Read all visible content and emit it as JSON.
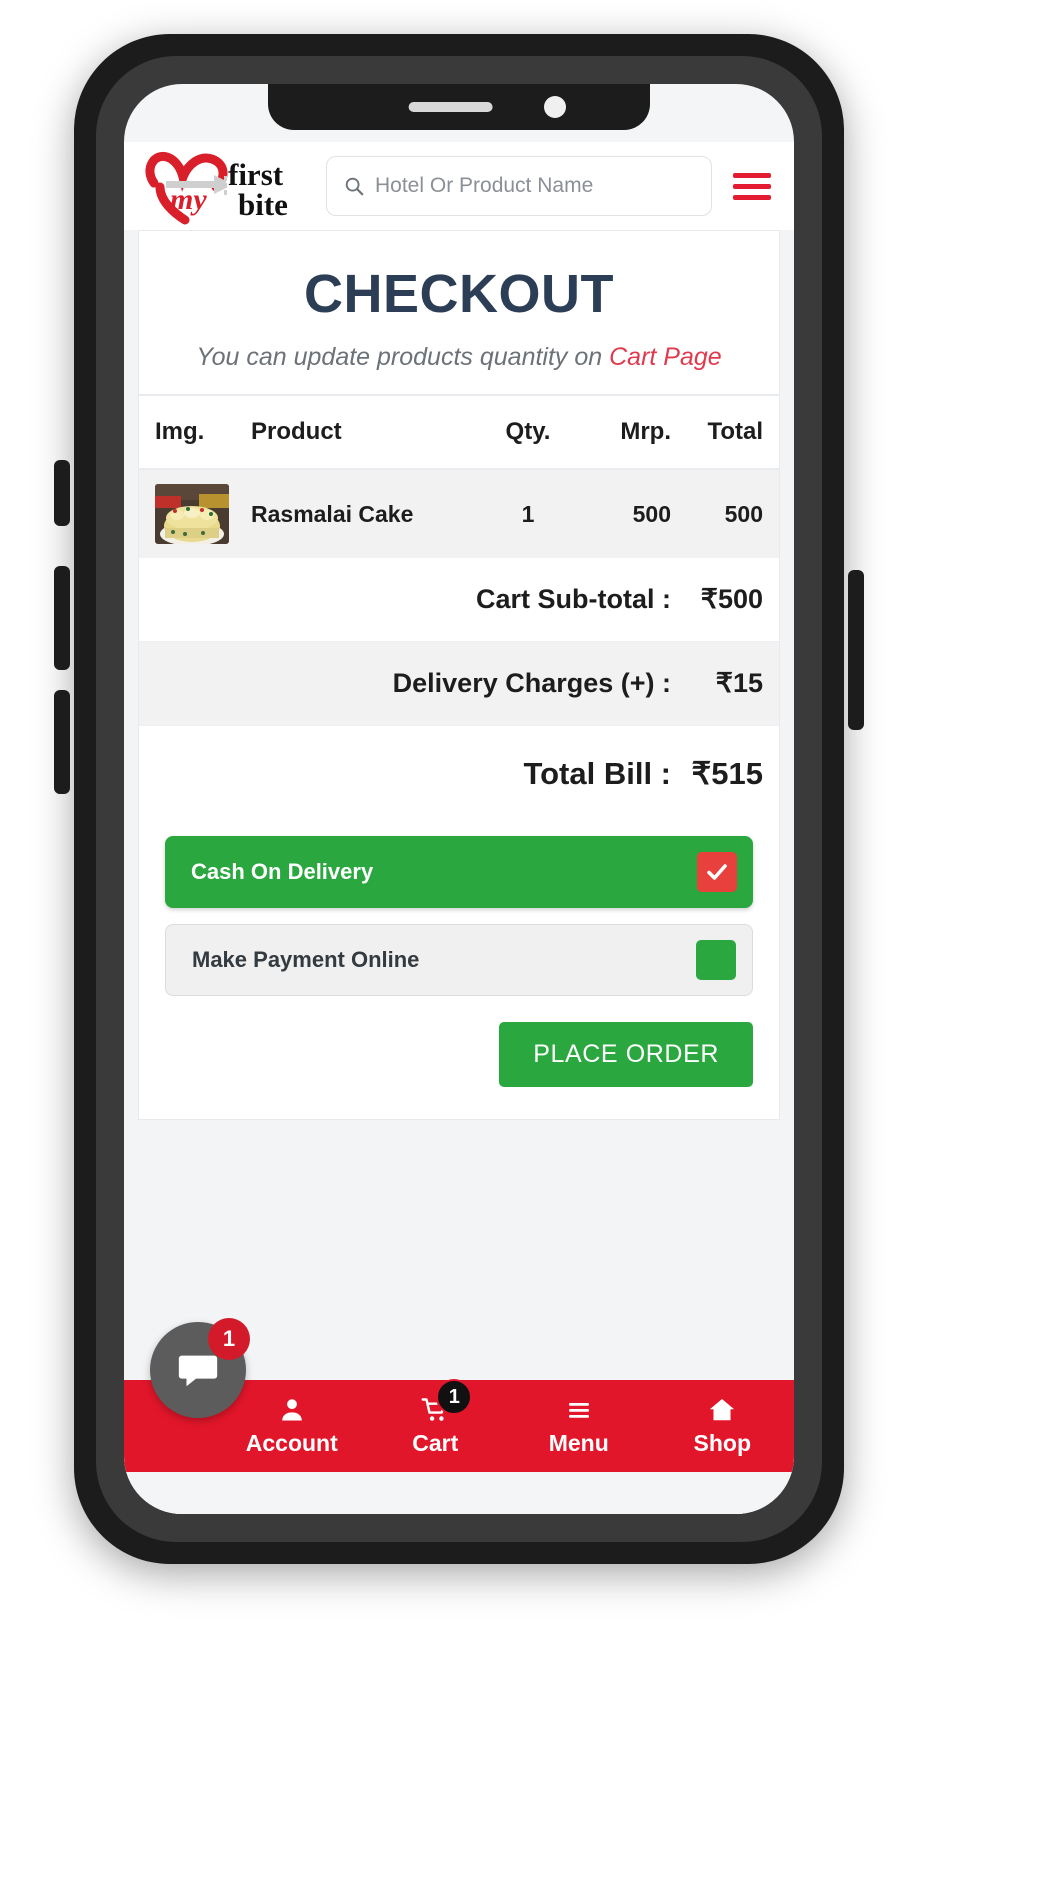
{
  "header": {
    "logo_text_line1": "my",
    "logo_text_line2": "first",
    "logo_text_line3": "bite",
    "logo_alt": "my first bite",
    "search_placeholder": "Hotel Or Product Name",
    "search_value": "",
    "menu_label": "Menu"
  },
  "checkout": {
    "title": "CHECKOUT",
    "subtitle_prefix": "You can update products quantity on ",
    "subtitle_link": "Cart Page"
  },
  "table": {
    "headers": {
      "img": "Img.",
      "product": "Product",
      "qty": "Qty.",
      "mrp": "Mrp.",
      "total": "Total"
    },
    "rows": [
      {
        "image_alt": "Rasmalai Cake",
        "product": "Rasmalai Cake",
        "qty": "1",
        "mrp": "500",
        "total": "500"
      }
    ]
  },
  "summary": {
    "subtotal_label": "Cart Sub-total :",
    "subtotal_value": "₹500",
    "delivery_label": "Delivery Charges (+) :",
    "delivery_value": "₹15",
    "total_label": "Total Bill :",
    "total_value": "₹515"
  },
  "payment": {
    "options": [
      {
        "label": "Cash On Delivery",
        "selected": true
      },
      {
        "label": "Make Payment Online",
        "selected": false
      }
    ],
    "place_order_label": "PLACE ORDER"
  },
  "chat": {
    "badge": "1"
  },
  "bottom_nav": {
    "items": [
      {
        "label": "Account",
        "icon": "user-icon",
        "badge": ""
      },
      {
        "label": "Cart",
        "icon": "cart-icon",
        "badge": "1"
      },
      {
        "label": "Menu",
        "icon": "hamburger-icon",
        "badge": ""
      },
      {
        "label": "Shop",
        "icon": "home-icon",
        "badge": ""
      }
    ]
  },
  "colors": {
    "brand_red": "#e2162a",
    "accent_green": "#2aa83f",
    "title_navy": "#2b3e55",
    "link_red": "#e03a4e"
  }
}
